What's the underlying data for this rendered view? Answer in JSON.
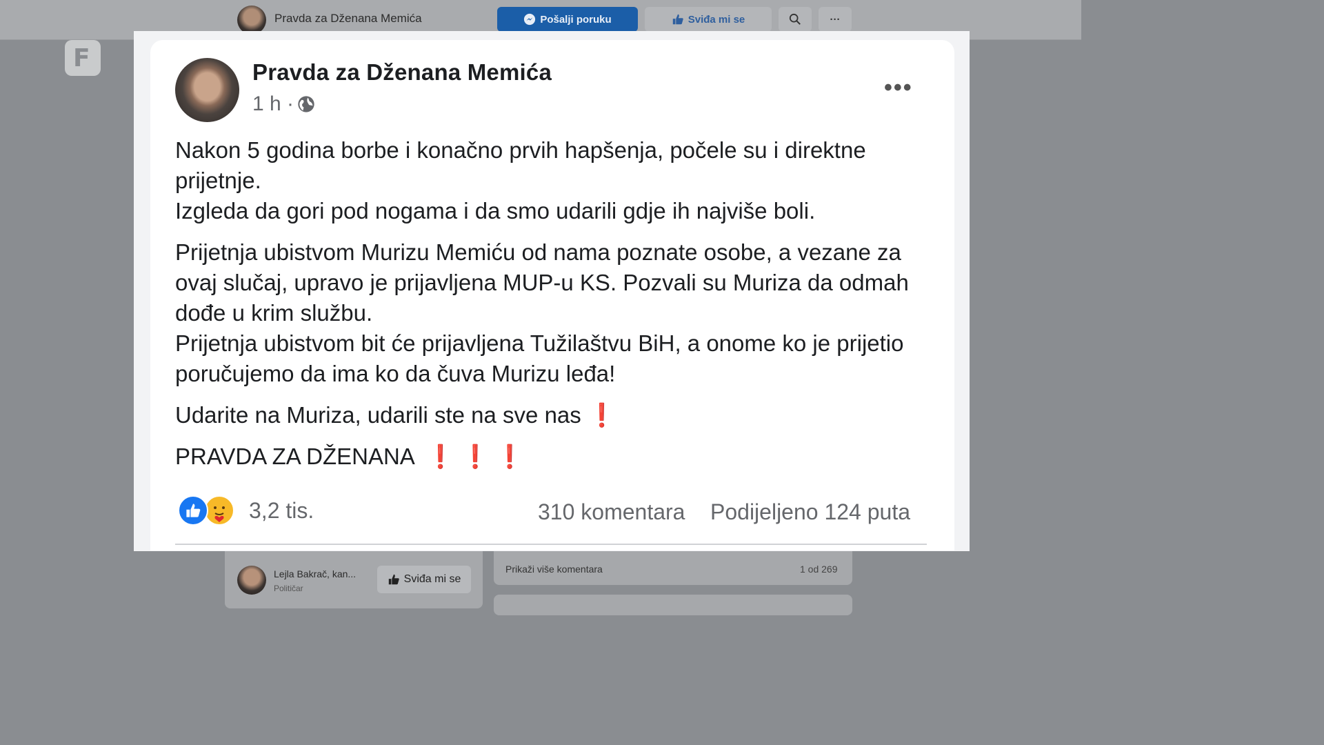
{
  "topbar": {
    "page_name": "Pravda za Dženana Memića",
    "send_message_label": "Pošalji poruku",
    "like_label": "Sviđa mi se",
    "search_icon": "search-icon",
    "more_icon": "more-icon"
  },
  "logo": {
    "letter": "F"
  },
  "post": {
    "author": "Pravda za Dženana Memića",
    "time": "1 h ·",
    "paragraphs": [
      "Nakon 5 godina borbe i konačno prvih hapšenja, počele su i direktne prijetnje.\nIzgleda da gori pod nogama i da smo udarili gdje ih najviše boli.",
      "Prijetnja ubistvom Murizu Memiću od nama poznate osobe, a vezane za ovaj slučaj, upravo je prijavljena MUP-u KS. Pozvali su Muriza da odmah dođe u krim službu.\nPrijetnja ubistvom bit će prijavljena Tužilaštvu BiH, a onome ko je prijetio poručujemo da ima ko da čuva Murizu leđa!",
      "Udarite na Muriza, udarili ste na sve nas",
      "PRAVDA ZA DŽENANA"
    ],
    "exclaim_1": "❗",
    "exclaim_2": "❗ ❗ ❗",
    "reactions_count": "3,2 tis.",
    "comments": "310 komentara",
    "shares": "Podijeljeno 124 puta"
  },
  "background": {
    "liker_name": "Lejla Bakrač, kan...",
    "liker_role": "Političar",
    "liker_like_label": "Sviđa mi se",
    "more_comments": "Prikaži više komentara",
    "comments_pager": "1 od 269"
  },
  "colors": {
    "brand_blue": "#1877f2",
    "exclaim_red": "#e0282e"
  }
}
